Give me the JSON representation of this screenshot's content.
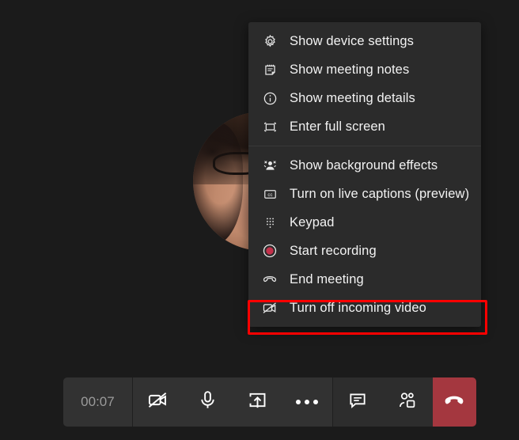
{
  "window": {
    "background_color": "#1b1b1b",
    "app": "Microsoft Teams meeting"
  },
  "video_stage": {
    "participant_avatar_label": "participant-video-circle"
  },
  "context_menu": {
    "background_color": "#2b2b2b",
    "groups": [
      {
        "items": [
          {
            "icon": "gear-icon",
            "label": "Show device settings"
          },
          {
            "icon": "notes-icon",
            "label": "Show meeting notes"
          },
          {
            "icon": "info-icon",
            "label": "Show meeting details"
          },
          {
            "icon": "fullscreen-icon",
            "label": "Enter full screen"
          }
        ]
      },
      {
        "items": [
          {
            "icon": "background-effects-icon",
            "label": "Show background effects"
          },
          {
            "icon": "closed-captions-icon",
            "label": "Turn on live captions (preview)"
          },
          {
            "icon": "keypad-icon",
            "label": "Keypad"
          },
          {
            "icon": "record-icon",
            "label": "Start recording"
          },
          {
            "icon": "hangup-icon",
            "label": "End meeting"
          },
          {
            "icon": "video-off-icon",
            "label": "Turn off incoming video"
          }
        ]
      }
    ]
  },
  "highlight": {
    "target_label": "End meeting",
    "color": "#fe0000"
  },
  "toolbar": {
    "timer": "00:07",
    "buttons": [
      {
        "icon": "camera-off-icon",
        "name": "toggle-camera-button"
      },
      {
        "icon": "microphone-icon",
        "name": "toggle-mic-button"
      },
      {
        "icon": "share-screen-icon",
        "name": "share-screen-button"
      },
      {
        "icon": "more-options-icon",
        "name": "more-options-button"
      },
      {
        "icon": "chat-icon",
        "name": "show-conversation-button"
      },
      {
        "icon": "people-icon",
        "name": "show-participants-button"
      }
    ],
    "hangup": {
      "icon": "hangup-icon",
      "name": "hangup-button",
      "color": "#a4373f"
    }
  }
}
